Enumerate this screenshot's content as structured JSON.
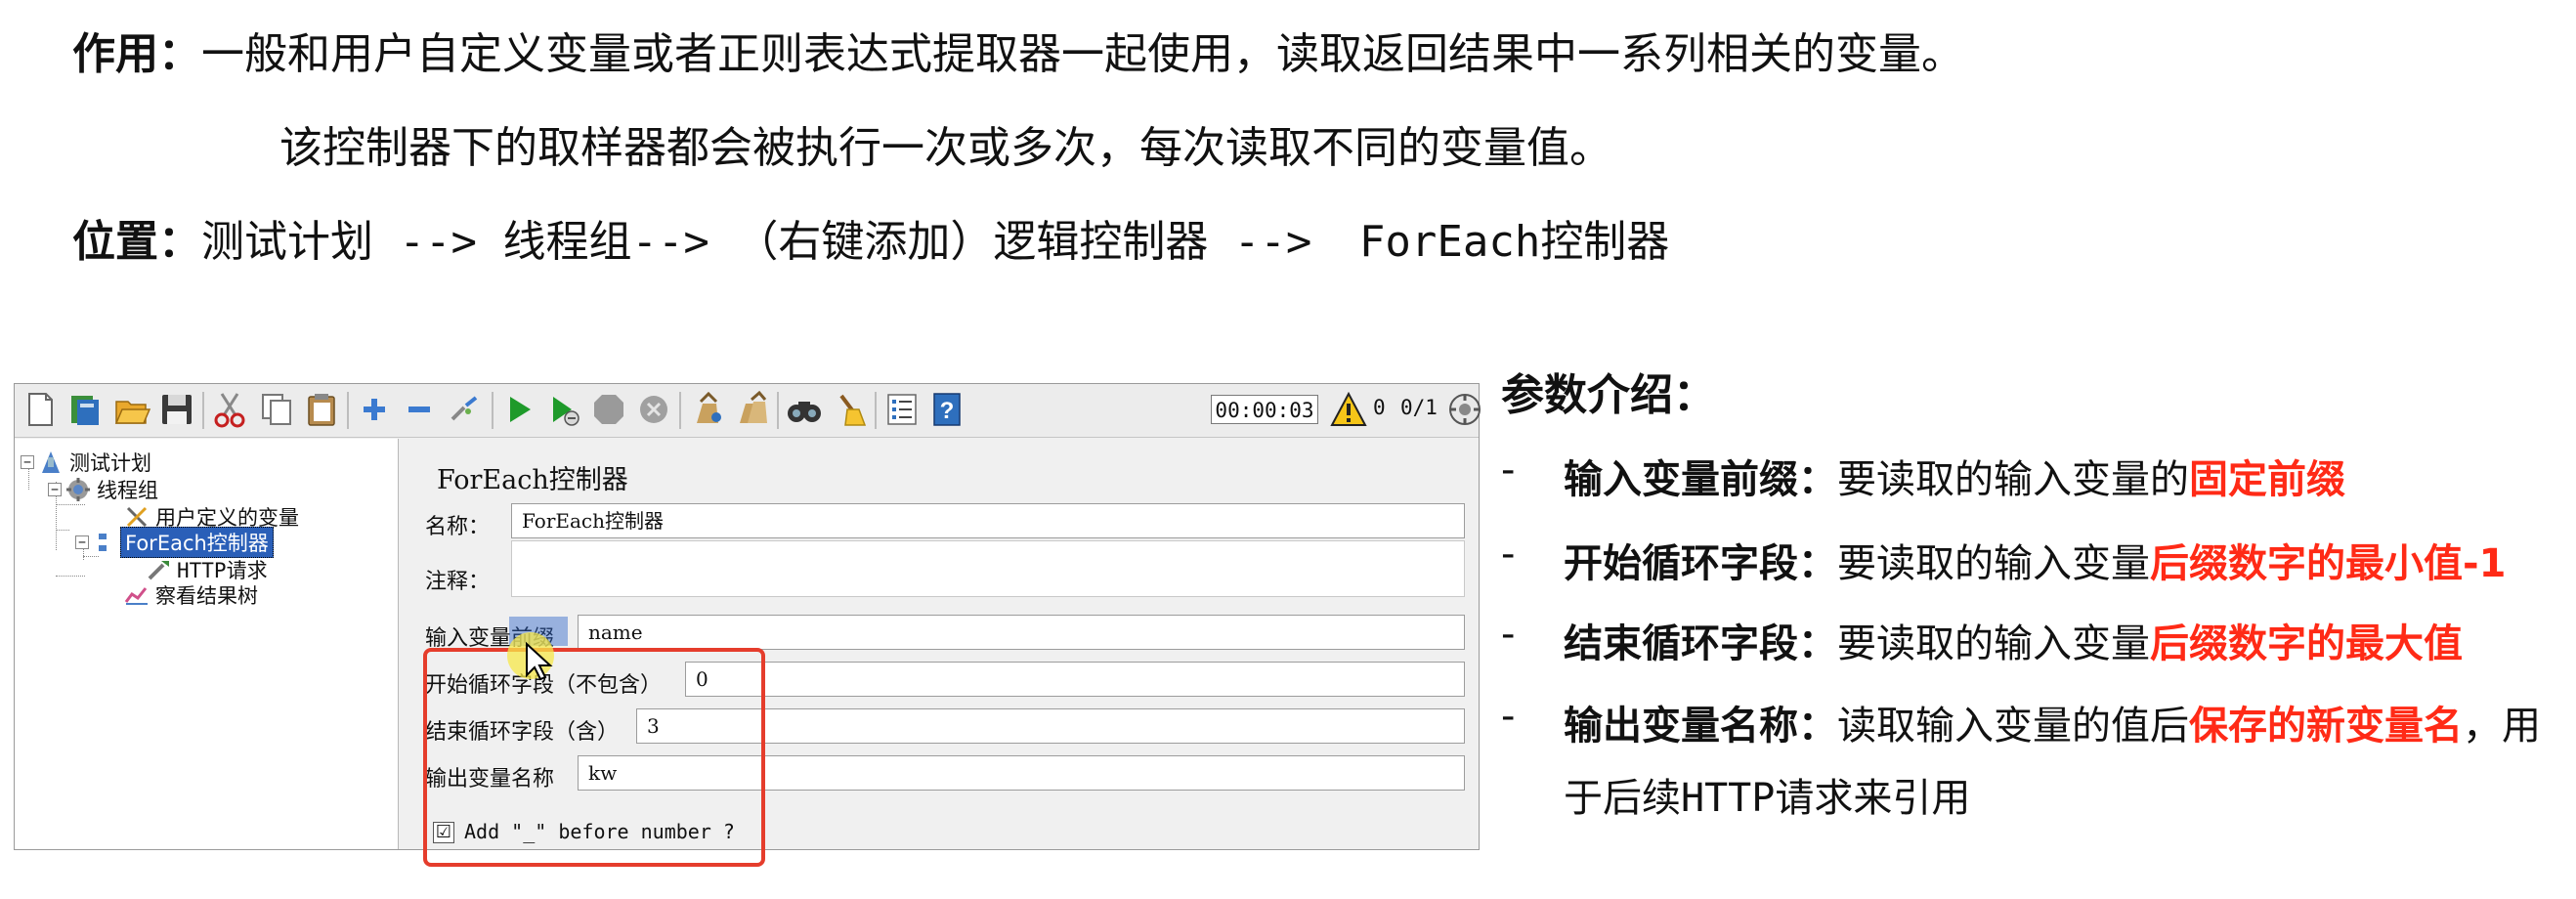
{
  "intro": {
    "purpose_label": "作用：",
    "purpose_text": "一般和用户自定义变量或者正则表达式提取器一起使用，读取返回结果中一系列相关的变量。",
    "purpose_text2": "该控制器下的取样器都会被执行一次或多次，每次读取不同的变量值。",
    "location_label": "位置：",
    "location_part1": "测试计划",
    "location_arrow1": " --> ",
    "location_part2": "线程组",
    "location_arrow2": "--> ",
    "location_part3": "（右键添加）逻辑控制器",
    "location_arrow3": " --> ",
    "location_part4_latin": "ForEach",
    "location_part4_cn": "控制器"
  },
  "toolbar": {
    "icons": [
      "new-icon",
      "templates-icon",
      "open-icon",
      "save-icon",
      "cut-icon",
      "copy-icon",
      "paste-icon",
      "expand-icon",
      "collapse-icon",
      "toggle-icon",
      "start-icon",
      "start-no-pause-icon",
      "stop-icon",
      "shutdown-icon",
      "clear-icon",
      "clear-all-icon",
      "search-icon",
      "reset-search-icon",
      "function-helper-icon",
      "help-icon"
    ],
    "timer": "00:00:03",
    "error_count": "0",
    "threads": "0/1"
  },
  "tree": {
    "items": [
      {
        "label": "测试计划",
        "icon": "test-plan-icon"
      },
      {
        "label": "线程组",
        "icon": "thread-group-icon"
      },
      {
        "label": "用户定义的变量",
        "icon": "user-variables-icon"
      },
      {
        "label": "ForEach控制器",
        "icon": "foreach-controller-icon"
      },
      {
        "label": "HTTP请求",
        "icon": "http-request-icon"
      },
      {
        "label": "察看结果树",
        "icon": "view-results-tree-icon"
      }
    ]
  },
  "form": {
    "title": "ForEach控制器",
    "name_label": "名称：",
    "name_value": "ForEach控制器",
    "comment_label": "注释：",
    "comment_value": "",
    "input_prefix_label": "输入变量前缀",
    "input_prefix_value": "name",
    "start_label": "开始循环字段（不包含）",
    "start_value": "0",
    "end_label": "结束循环字段（含）",
    "end_value": "3",
    "output_label": "输出变量名称",
    "output_value": "kw",
    "checkbox_label": "Add \"_\" before number ?",
    "checkbox_checked": "☑"
  },
  "params": {
    "title": "参数介绍：",
    "bullet": "-",
    "items": [
      {
        "label": "输入变量前缀：",
        "text": "要读取的输入变量的",
        "highlight": "固定前缀",
        "rest": ""
      },
      {
        "label": "开始循环字段：",
        "text": "要读取的输入变量",
        "highlight": "后缀数字的最小值-1",
        "rest": ""
      },
      {
        "label": "结束循环字段：",
        "text": "要读取的输入变量",
        "highlight": "后缀数字的最大值",
        "rest": ""
      },
      {
        "label": "输出变量名称：",
        "text": "读取输入变量的值后",
        "highlight": "保存的新变量名",
        "rest": "，用"
      }
    ],
    "continuation_cn1": "于后续",
    "continuation_latin": "HTTP",
    "continuation_cn2": "请求来引用"
  },
  "colors": {
    "highlight_red": "#ff2a16",
    "box_red": "#e53d2c",
    "selection_blue": "#2a5fb8"
  }
}
